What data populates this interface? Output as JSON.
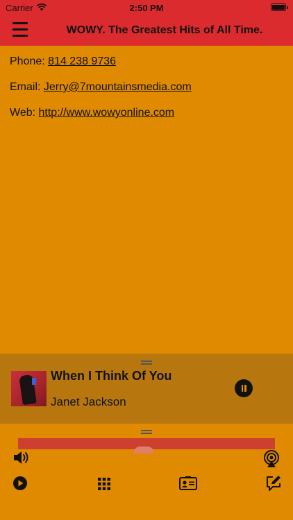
{
  "status_bar": {
    "carrier": "Carrier",
    "time": "2:50 PM"
  },
  "nav": {
    "title": "WOWY. The Greatest Hits of All Time."
  },
  "contact": [
    {
      "label": "Phone: ",
      "value": "814 238 9736"
    },
    {
      "label": "Email: ",
      "value": "Jerry@7mountainsmedia.com"
    },
    {
      "label": "Web: ",
      "value": "http://www.wowyonline.com"
    }
  ],
  "now_playing": {
    "title": "When I Think Of You",
    "artist": "Janet Jackson"
  },
  "icons": {
    "menu": "hamburger-menu-icon",
    "volume": "speaker-icon",
    "airplay": "airplay-icon",
    "play": "play-icon",
    "grid": "grid-icon",
    "contact_card": "contact-card-icon",
    "compose": "compose-icon",
    "pause": "pause-icon"
  },
  "colors": {
    "header": "#DC2B2E",
    "background": "#DF8A00",
    "mini_player": "#B7770E"
  }
}
